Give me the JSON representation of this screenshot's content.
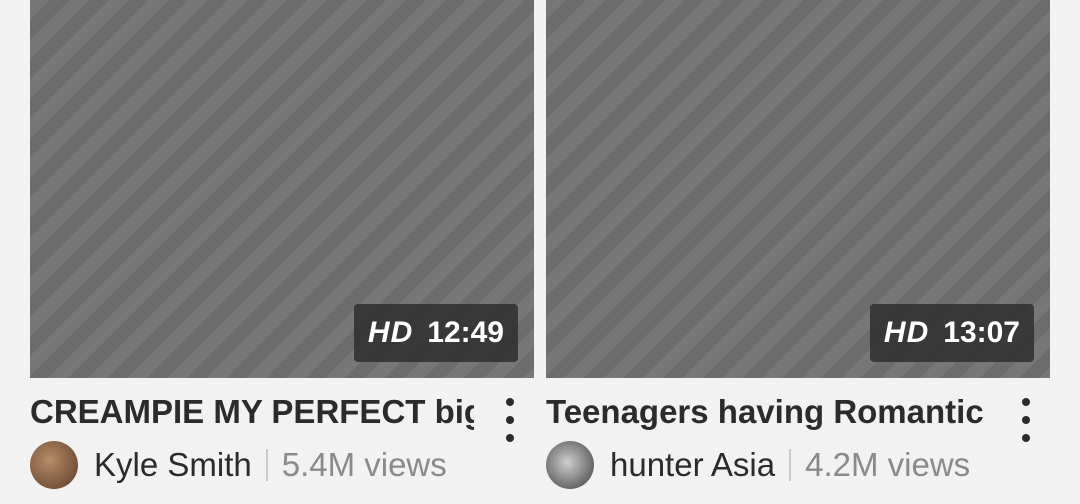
{
  "videos": [
    {
      "duration_badge": "HD",
      "duration": "12:49",
      "title": "CREAMPIE MY PERFECT big",
      "channel": "Kyle Smith",
      "views": "5.4M views"
    },
    {
      "duration_badge": "HD",
      "duration": "13:07",
      "title": "Teenagers having Romantic",
      "channel": "hunter Asia",
      "views": "4.2M views"
    }
  ],
  "icons": {
    "more": "kebab-menu-icon",
    "avatar": "channel-avatar"
  },
  "colors": {
    "page_bg": "#f2f2f2",
    "title": "#2b2b2b",
    "muted": "#8a8a8a",
    "badge_bg": "rgba(40,40,40,0.78)"
  }
}
